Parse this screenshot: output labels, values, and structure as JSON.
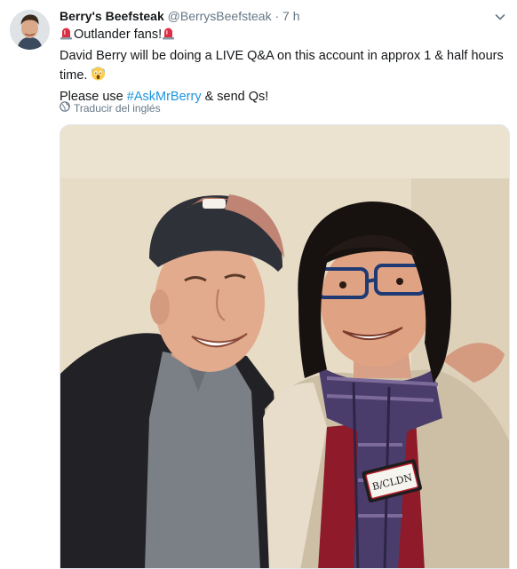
{
  "tweet": {
    "display_name": "Berry's Beefsteak",
    "handle": "@BerrysBeefsteak",
    "separator": "·",
    "time": "7 h",
    "line1": "Outlander fans!",
    "line2": "David Berry will be doing a LIVE Q&A on this account in approx 1 & half hours",
    "line3": "time.",
    "line4_prefix": "Please use ",
    "hashtag": "#AskMrBerry",
    "line4_suffix": " & send Qs!",
    "translate_label": "Traducir del inglés",
    "name_tag_text": "B/CLDN"
  },
  "icons": {
    "siren": "siren-emoji",
    "scream": "scream-emoji",
    "globe": "globe-icon",
    "caret": "chevron-down-icon"
  },
  "colors": {
    "text": "#14171a",
    "secondary": "#657786",
    "link": "#1b95e0"
  }
}
